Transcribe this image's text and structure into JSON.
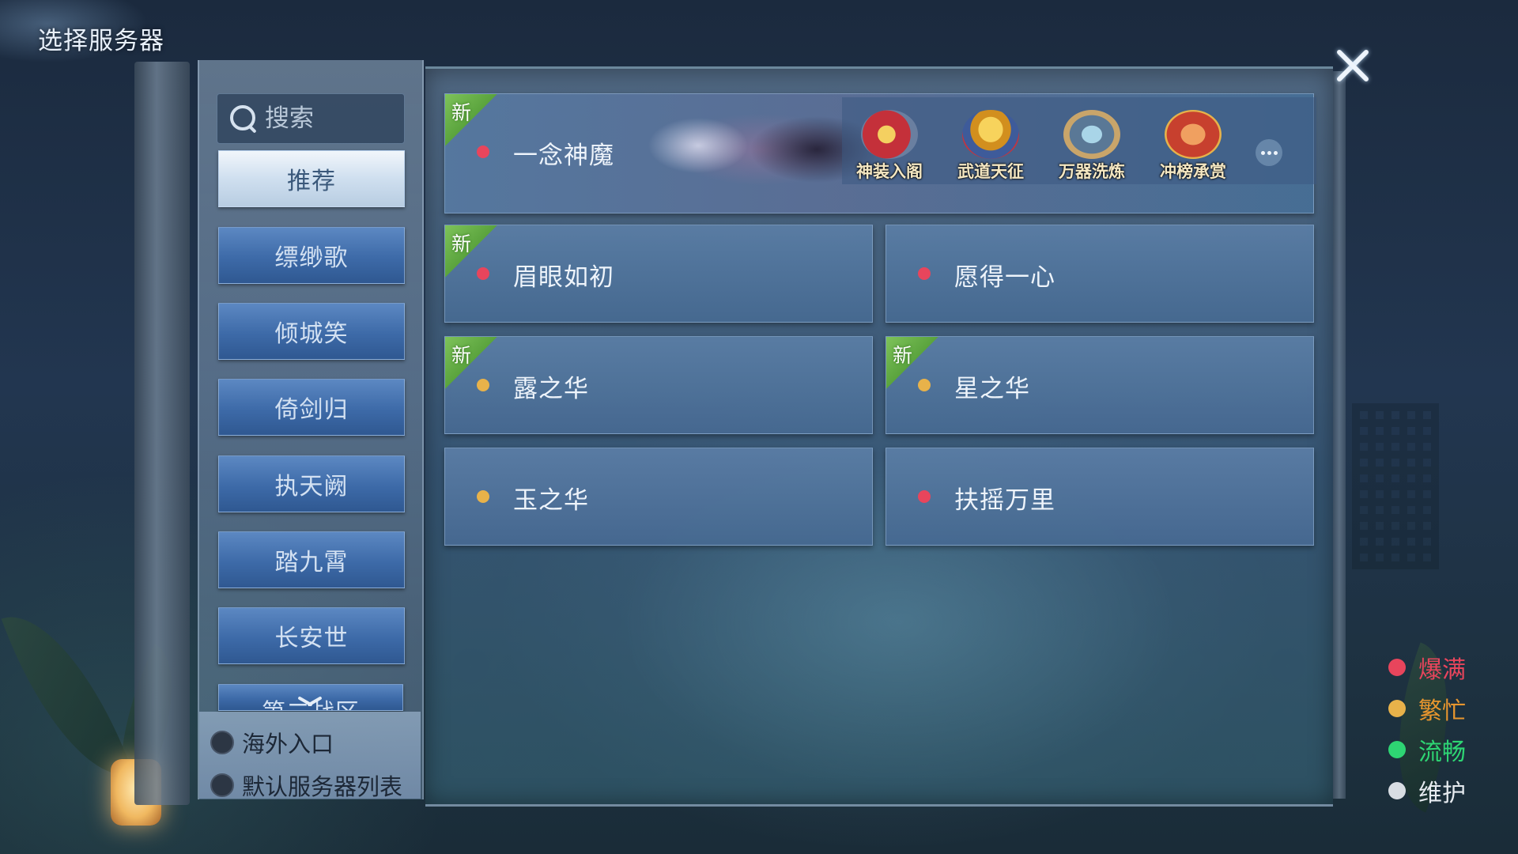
{
  "window": {
    "title": "选择服务器"
  },
  "search": {
    "placeholder": "搜索"
  },
  "sidebar": {
    "tabs": [
      {
        "label": "推荐",
        "active": true
      },
      {
        "label": "缥缈歌"
      },
      {
        "label": "倾城笑"
      },
      {
        "label": "倚剑归"
      },
      {
        "label": "执天阙"
      },
      {
        "label": "踏九霄"
      },
      {
        "label": "长安世"
      },
      {
        "label": "第二战区",
        "partial": true
      }
    ],
    "options": [
      {
        "label": "海外入口"
      },
      {
        "label": "默认服务器列表"
      }
    ]
  },
  "featured": {
    "name": "一念神魔",
    "badge": "新",
    "status": "爆满",
    "events": [
      {
        "label": "神装入阁",
        "icon": "coin-icon"
      },
      {
        "label": "武道天征",
        "icon": "trophy-icon"
      },
      {
        "label": "万器洗炼",
        "icon": "weapons-icon"
      },
      {
        "label": "冲榜承赏",
        "icon": "ranking-icon"
      }
    ],
    "more_icon": "more-icon"
  },
  "servers": [
    {
      "name": "眉眼如初",
      "status": "爆满",
      "badge": "新"
    },
    {
      "name": "愿得一心",
      "status": "爆满",
      "badge": ""
    },
    {
      "name": "露之华",
      "status": "繁忙",
      "badge": "新"
    },
    {
      "name": "星之华",
      "status": "繁忙",
      "badge": "新"
    },
    {
      "name": "玉之华",
      "status": "繁忙",
      "badge": ""
    },
    {
      "name": "扶摇万里",
      "status": "爆满",
      "badge": ""
    }
  ],
  "legend": [
    {
      "label": "爆满",
      "color": "#e8455c"
    },
    {
      "label": "繁忙",
      "color": "#e8b24a"
    },
    {
      "label": "流畅",
      "color": "#2ed573"
    },
    {
      "label": "维护",
      "color": "#d8dde3"
    }
  ],
  "colors": {
    "full": "#e8455c",
    "busy": "#e8b24a",
    "smooth": "#2ed573",
    "maintenance": "#d8dde3",
    "new_badge": "#6cb84a",
    "tab_active": "#dfe9f4",
    "tab": "#4472b0"
  }
}
